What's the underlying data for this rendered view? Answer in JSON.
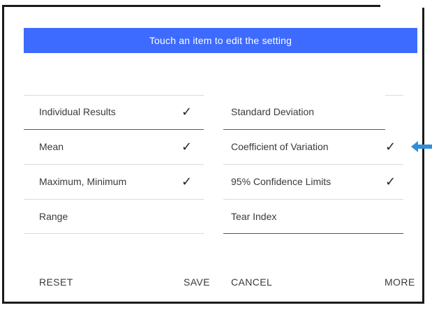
{
  "banner": {
    "text": "Touch an item to edit the setting"
  },
  "left_items": [
    {
      "label": "Individual Results",
      "checked": true,
      "check": "✓"
    },
    {
      "label": "Mean",
      "checked": true,
      "check": "✓"
    },
    {
      "label": "Maximum, Minimum",
      "checked": true,
      "check": "✓"
    },
    {
      "label": "Range",
      "checked": false,
      "check": ""
    }
  ],
  "right_items": [
    {
      "label": "Standard Deviation",
      "checked": false,
      "check": ""
    },
    {
      "label": "Coefficient of Variation",
      "checked": true,
      "check": "✓"
    },
    {
      "label": "95% Confidence Limits",
      "checked": true,
      "check": "✓"
    },
    {
      "label": "Tear Index",
      "checked": false,
      "check": ""
    }
  ],
  "footer": {
    "reset": "RESET",
    "save": "SAVE",
    "cancel": "CANCEL",
    "more": "MORE"
  },
  "colors": {
    "banner": "#3d6bff",
    "arrow": "#2f8fd8"
  },
  "icons": {
    "check": "check-icon",
    "arrow": "arrow-left-icon"
  }
}
